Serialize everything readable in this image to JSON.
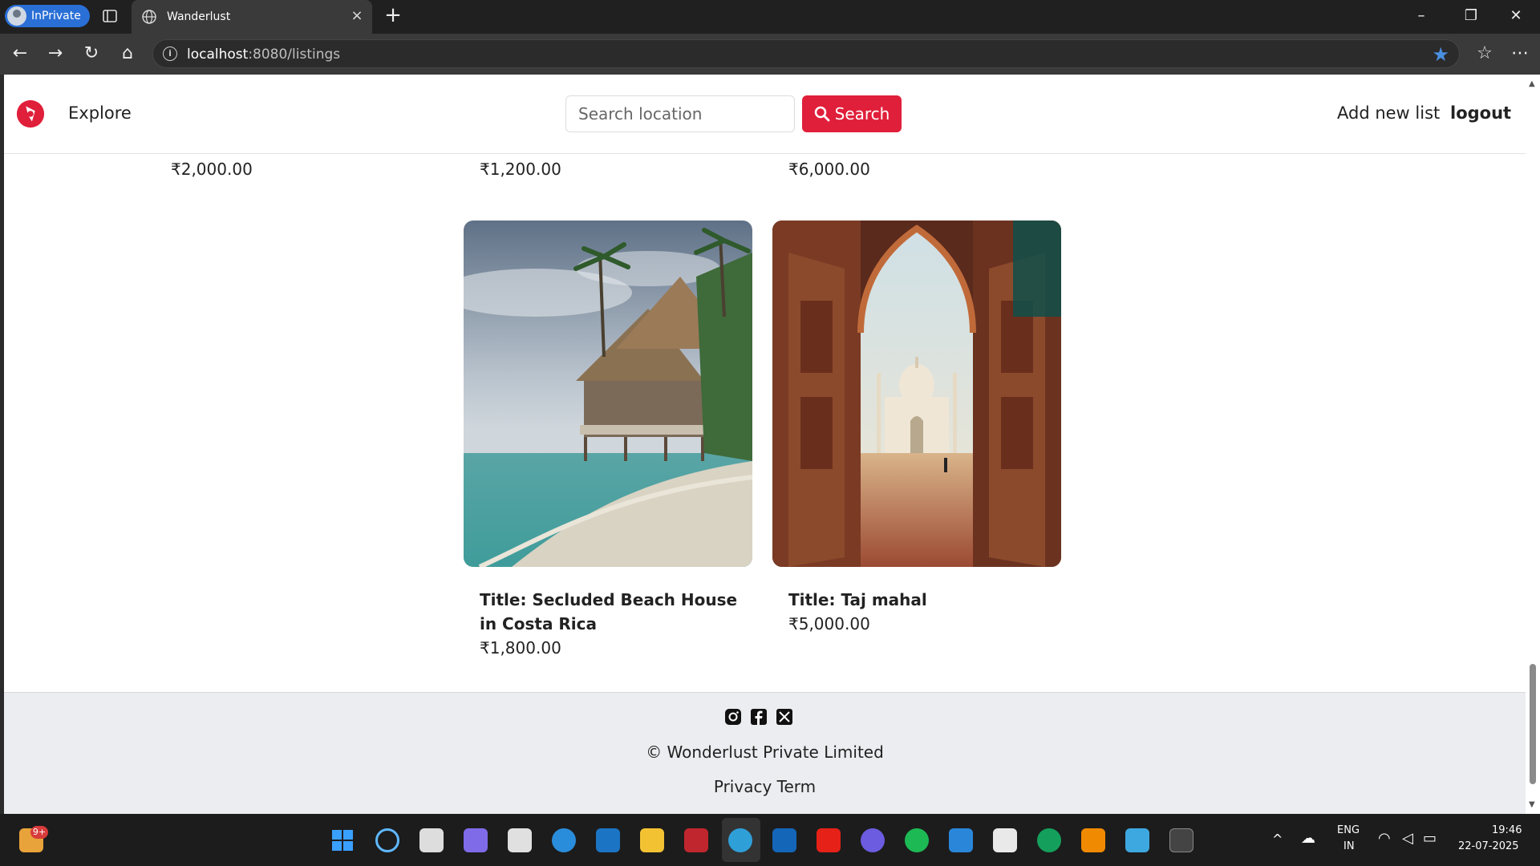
{
  "browser": {
    "inprivate_label": "InPrivate",
    "tab_title": "Wanderlust",
    "url_host": "localhost",
    "url_path": ":8080/listings"
  },
  "header": {
    "explore_label": "Explore",
    "search_placeholder": "Search location",
    "search_button_label": "Search",
    "add_list_label": "Add new list",
    "logout_label": "logout"
  },
  "partial_row_prices": [
    "₹2,000.00",
    "₹1,200.00",
    "₹6,000.00"
  ],
  "listings": [
    {
      "title": "Title: Secluded Beach House in Costa Rica",
      "price": "₹1,800.00"
    },
    {
      "title": "Title: Taj mahal",
      "price": "₹5,000.00"
    }
  ],
  "footer": {
    "copyright": "© Wonderlust Private Limited",
    "policy_links": "Privacy Term"
  },
  "taskbar": {
    "notification_badge": "9+",
    "lang_primary": "ENG",
    "lang_secondary": "IN",
    "time": "19:46",
    "date": "22-07-2025"
  },
  "colors": {
    "brand": "#e01f3a",
    "footer_bg": "#ebedf0"
  }
}
